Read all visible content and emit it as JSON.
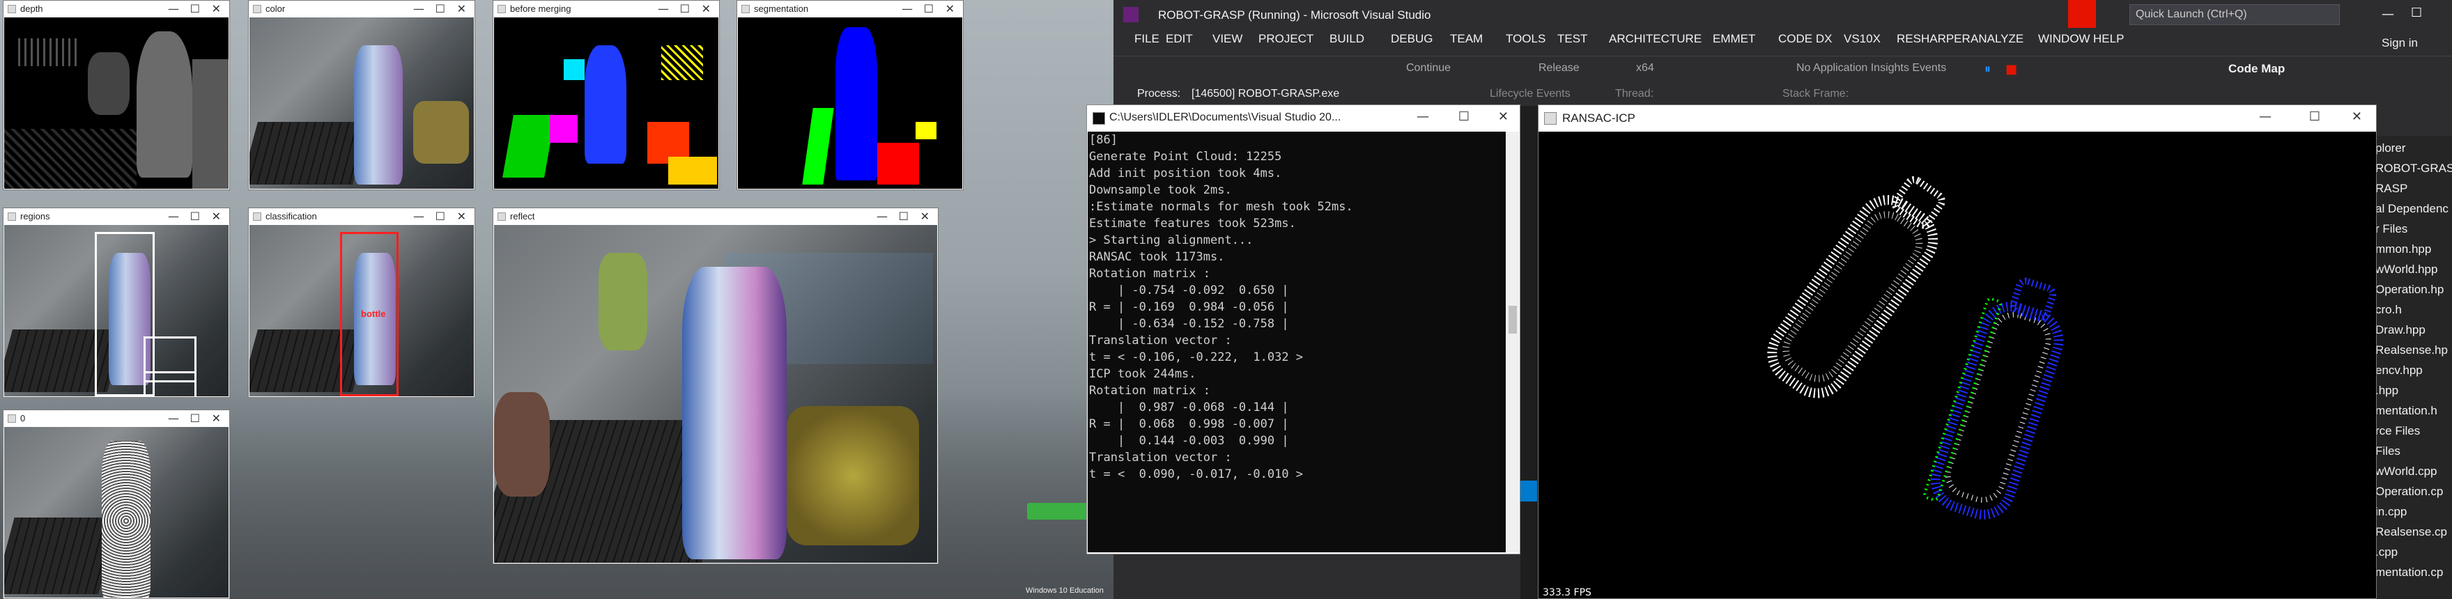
{
  "taskbar_hint": "Windows 10 Education",
  "opencv_windows": [
    {
      "title": "depth"
    },
    {
      "title": "color"
    },
    {
      "title": "before merging"
    },
    {
      "title": "segmentation"
    },
    {
      "title": "regions"
    },
    {
      "title": "classification"
    },
    {
      "title": "reflect"
    },
    {
      "title": "0"
    }
  ],
  "classification_label": "bottle",
  "vs": {
    "title": "ROBOT-GRASP (Running) - Microsoft Visual Studio",
    "quick_launch": "Quick Launch (Ctrl+Q)",
    "menu": [
      "FILE",
      "EDIT",
      "VIEW",
      "PROJECT",
      "BUILD",
      "DEBUG",
      "TEAM",
      "TOOLS",
      "TEST",
      "ARCHITECTURE",
      "EMMET",
      "CODE DX",
      "VS10X",
      "RESHARPER",
      "ANALYZE",
      "WINDOW",
      "HELP"
    ],
    "sign_in": "Sign in",
    "continue": "Continue",
    "config": "Release",
    "platform": "x64",
    "insights": "No Application Insights Events",
    "code_map": "Code Map",
    "process_label": "Process:",
    "process_value": "[146500] ROBOT-GRASP.exe",
    "lifecycle": "Lifecycle Events",
    "thread": "Thread:",
    "stack": "Stack Frame:",
    "solution_items": [
      "plorer",
      "ROBOT-GRASP' (",
      "RASP",
      "al Dependenc",
      "r Files",
      "mmon.hpp",
      "wWorld.hpp",
      "Operation.hp",
      "cro.h",
      "Draw.hpp",
      "Realsense.hp",
      "encv.hpp",
      ".hpp",
      "mentation.h",
      "rce Files",
      "Files",
      "wWorld.cpp",
      "Operation.cp",
      "in.cpp",
      "Realsense.cp",
      ".cpp",
      "mentation.cp"
    ]
  },
  "console": {
    "title": "C:\\Users\\IDLER\\Documents\\Visual Studio 20...",
    "lines": [
      "[86]",
      "Generate Point Cloud: 12255",
      "Add init position took 4ms.",
      "Downsample took 2ms.",
      ":Estimate normals for mesh took 52ms.",
      "Estimate features took 523ms.",
      "> Starting alignment...",
      "RANSAC took 1173ms.",
      "Rotation matrix :",
      "    | -0.754 -0.092  0.650 |",
      "R = | -0.169  0.984 -0.056 |",
      "    | -0.634 -0.152 -0.758 |",
      "Translation vector :",
      "t = < -0.106, -0.222,  1.032 >",
      "",
      "ICP took 244ms.",
      "Rotation matrix :",
      "    |  0.987 -0.068 -0.144 |",
      "R = |  0.068  0.998 -0.007 |",
      "    |  0.144 -0.003  0.990 |",
      "Translation vector :",
      "t = <  0.090, -0.017, -0.010 >"
    ]
  },
  "ransac": {
    "title": "RANSAC-ICP",
    "fps": "333.3 FPS"
  },
  "colors": {
    "accent": "#e51400",
    "vs_bg": "#2d2d30",
    "seg_blue": "#0000ff",
    "seg_green": "#00ff00",
    "seg_red": "#ff0000",
    "seg_yellow": "#ffff00"
  }
}
